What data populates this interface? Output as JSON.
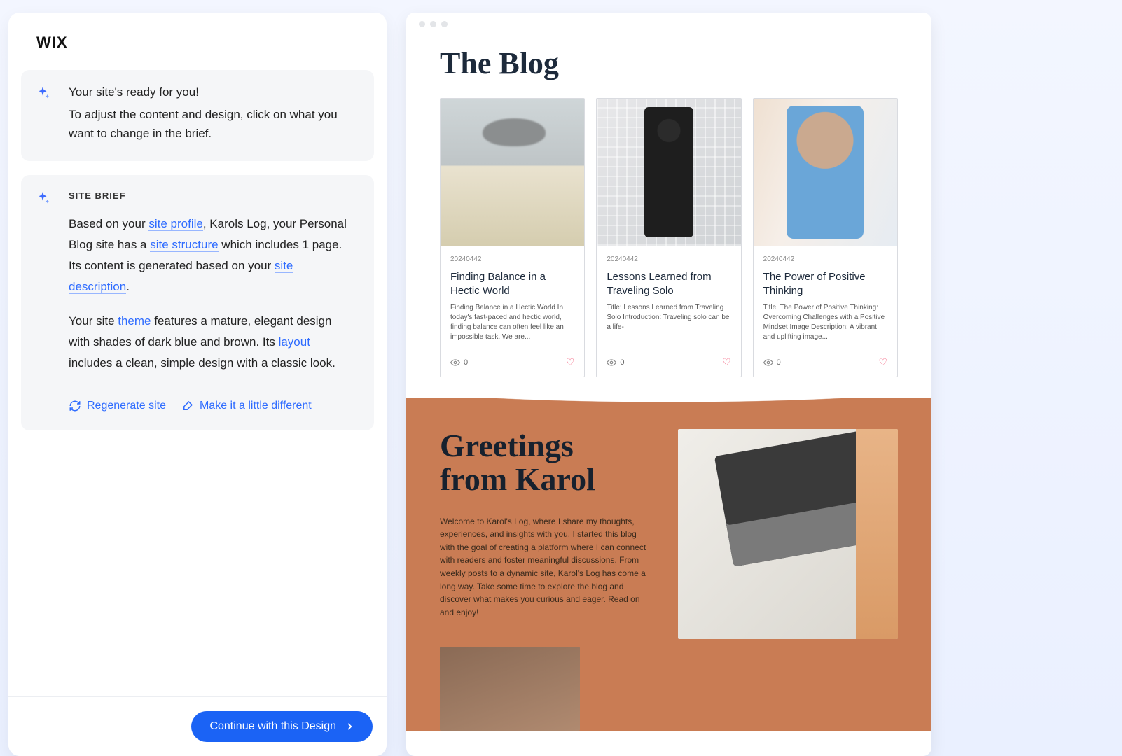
{
  "logo_text": "WIX",
  "assistant_card": {
    "line1": "Your site's ready for you!",
    "line2": "To adjust the content and design, click on what you want to change in the brief."
  },
  "brief": {
    "title": "SITE BRIEF",
    "p1_a": "Based on your ",
    "link_profile": "site profile",
    "p1_b": ", Karols Log, your Personal Blog site has a ",
    "link_structure": "site structure",
    "p1_c": " which includes 1 page. Its content is generated based on your ",
    "link_description": "site description",
    "p1_d": ".",
    "p2_a": "Your site ",
    "link_theme": "theme",
    "p2_b": " features a mature, elegant design with shades of dark blue and brown. Its ",
    "link_layout": "layout",
    "p2_c": " includes a clean, simple design with a classic look.",
    "regen_label": "Regenerate site",
    "vary_label": "Make it a little different"
  },
  "primary_button": "Continue with this Design",
  "preview": {
    "blog_title": "The Blog",
    "posts": [
      {
        "date": "20240442",
        "title": "Finding Balance in a Hectic World",
        "excerpt": "Finding Balance in a Hectic World In today's fast-paced and hectic world, finding balance can often feel like an impossible task. We are...",
        "views": "0"
      },
      {
        "date": "20240442",
        "title": "Lessons Learned from Traveling Solo",
        "excerpt": "Title: Lessons Learned from Traveling Solo Introduction: Traveling solo can be a life-",
        "views": "0"
      },
      {
        "date": "20240442",
        "title": "The Power of Positive Thinking",
        "excerpt": "Title: The Power of Positive Thinking: Overcoming Challenges with a Positive Mindset Image Description: A vibrant and uplifting image...",
        "views": "0"
      }
    ],
    "greetings_title_l1": "Greetings",
    "greetings_title_l2": "from Karol",
    "greetings_body": "Welcome to Karol's Log, where I share my thoughts, experiences, and insights with you. I started this blog with the goal of creating a platform where I can connect with readers and foster meaningful discussions. From weekly posts to a dynamic site, Karol's Log has come a long way. Take some time to explore the blog and discover what makes you curious and eager. Read on and enjoy!"
  }
}
